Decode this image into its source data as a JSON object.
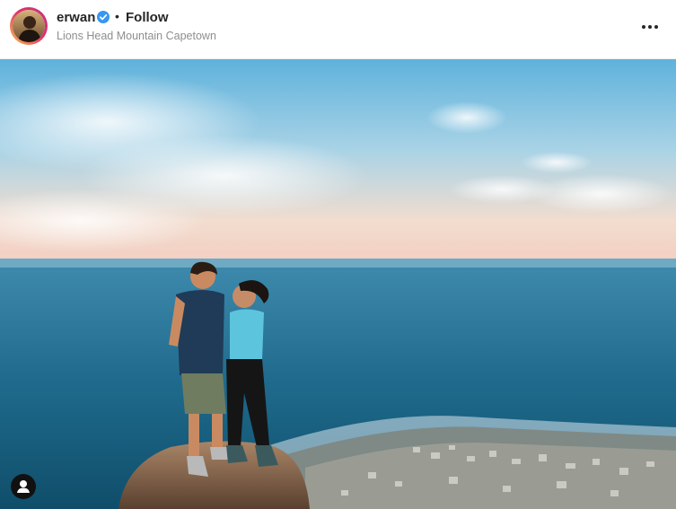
{
  "post": {
    "username": "erwan",
    "verified": true,
    "separator": "•",
    "follow_label": "Follow",
    "location": "Lions Head Mountain Capetown"
  },
  "icons": {
    "verified": "verified-badge-icon",
    "more": "more-options-icon",
    "user_tag": "user-tag-icon"
  },
  "colors": {
    "verified_blue": "#3897f0",
    "text_primary": "#262626",
    "text_secondary": "#8e8e8e"
  }
}
